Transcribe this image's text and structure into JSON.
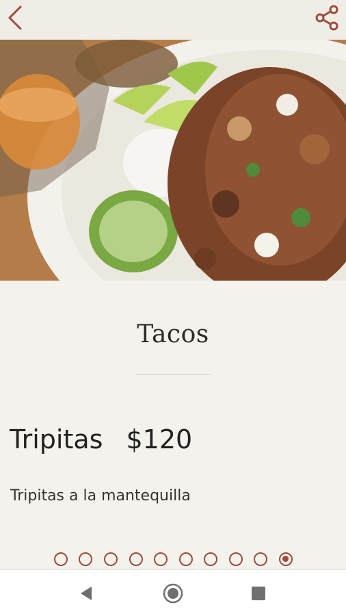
{
  "header": {
    "back_icon": "chevron-left-icon",
    "share_icon": "share-icon",
    "accent_color": "#9e4a3a"
  },
  "hero": {
    "description": "Photo of tacos de tripitas on a plate with chopped onion, cilantro, lime wedges and a cup of salsa"
  },
  "menu": {
    "category": "Tacos",
    "item_name": "Tripitas",
    "price": "$120",
    "description": "Tripitas a la mantequilla"
  },
  "pager": {
    "total": 10,
    "current": 10
  },
  "system_nav": {
    "back_icon": "triangle-back-icon",
    "home_icon": "circle-home-icon",
    "recents_icon": "square-recents-icon"
  }
}
